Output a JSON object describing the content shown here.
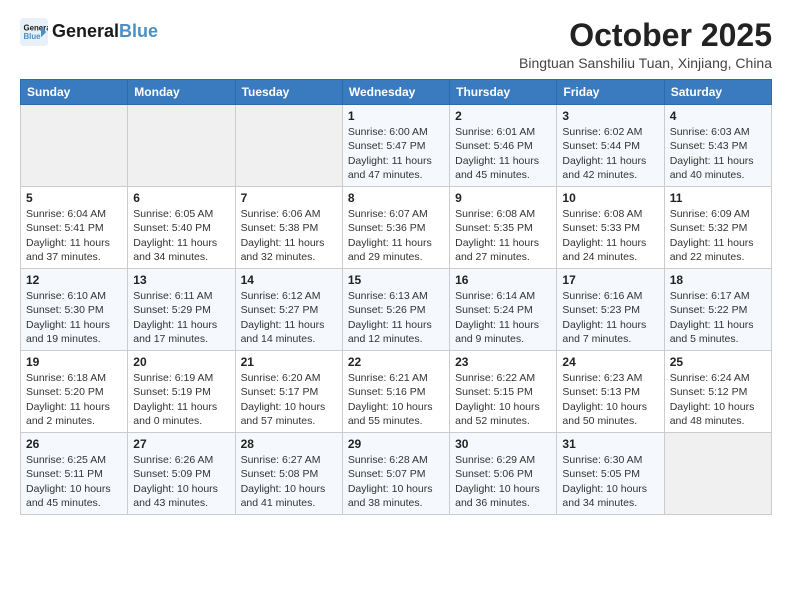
{
  "logo": {
    "line1": "General",
    "line2": "Blue",
    "icon_color": "#4a90c4"
  },
  "header": {
    "month_title": "October 2025",
    "subtitle": "Bingtuan Sanshiliu Tuan, Xinjiang, China"
  },
  "weekdays": [
    "Sunday",
    "Monday",
    "Tuesday",
    "Wednesday",
    "Thursday",
    "Friday",
    "Saturday"
  ],
  "weeks": [
    [
      {
        "day": "",
        "info": ""
      },
      {
        "day": "",
        "info": ""
      },
      {
        "day": "",
        "info": ""
      },
      {
        "day": "1",
        "info": "Sunrise: 6:00 AM\nSunset: 5:47 PM\nDaylight: 11 hours\nand 47 minutes."
      },
      {
        "day": "2",
        "info": "Sunrise: 6:01 AM\nSunset: 5:46 PM\nDaylight: 11 hours\nand 45 minutes."
      },
      {
        "day": "3",
        "info": "Sunrise: 6:02 AM\nSunset: 5:44 PM\nDaylight: 11 hours\nand 42 minutes."
      },
      {
        "day": "4",
        "info": "Sunrise: 6:03 AM\nSunset: 5:43 PM\nDaylight: 11 hours\nand 40 minutes."
      }
    ],
    [
      {
        "day": "5",
        "info": "Sunrise: 6:04 AM\nSunset: 5:41 PM\nDaylight: 11 hours\nand 37 minutes."
      },
      {
        "day": "6",
        "info": "Sunrise: 6:05 AM\nSunset: 5:40 PM\nDaylight: 11 hours\nand 34 minutes."
      },
      {
        "day": "7",
        "info": "Sunrise: 6:06 AM\nSunset: 5:38 PM\nDaylight: 11 hours\nand 32 minutes."
      },
      {
        "day": "8",
        "info": "Sunrise: 6:07 AM\nSunset: 5:36 PM\nDaylight: 11 hours\nand 29 minutes."
      },
      {
        "day": "9",
        "info": "Sunrise: 6:08 AM\nSunset: 5:35 PM\nDaylight: 11 hours\nand 27 minutes."
      },
      {
        "day": "10",
        "info": "Sunrise: 6:08 AM\nSunset: 5:33 PM\nDaylight: 11 hours\nand 24 minutes."
      },
      {
        "day": "11",
        "info": "Sunrise: 6:09 AM\nSunset: 5:32 PM\nDaylight: 11 hours\nand 22 minutes."
      }
    ],
    [
      {
        "day": "12",
        "info": "Sunrise: 6:10 AM\nSunset: 5:30 PM\nDaylight: 11 hours\nand 19 minutes."
      },
      {
        "day": "13",
        "info": "Sunrise: 6:11 AM\nSunset: 5:29 PM\nDaylight: 11 hours\nand 17 minutes."
      },
      {
        "day": "14",
        "info": "Sunrise: 6:12 AM\nSunset: 5:27 PM\nDaylight: 11 hours\nand 14 minutes."
      },
      {
        "day": "15",
        "info": "Sunrise: 6:13 AM\nSunset: 5:26 PM\nDaylight: 11 hours\nand 12 minutes."
      },
      {
        "day": "16",
        "info": "Sunrise: 6:14 AM\nSunset: 5:24 PM\nDaylight: 11 hours\nand 9 minutes."
      },
      {
        "day": "17",
        "info": "Sunrise: 6:16 AM\nSunset: 5:23 PM\nDaylight: 11 hours\nand 7 minutes."
      },
      {
        "day": "18",
        "info": "Sunrise: 6:17 AM\nSunset: 5:22 PM\nDaylight: 11 hours\nand 5 minutes."
      }
    ],
    [
      {
        "day": "19",
        "info": "Sunrise: 6:18 AM\nSunset: 5:20 PM\nDaylight: 11 hours\nand 2 minutes."
      },
      {
        "day": "20",
        "info": "Sunrise: 6:19 AM\nSunset: 5:19 PM\nDaylight: 11 hours\nand 0 minutes."
      },
      {
        "day": "21",
        "info": "Sunrise: 6:20 AM\nSunset: 5:17 PM\nDaylight: 10 hours\nand 57 minutes."
      },
      {
        "day": "22",
        "info": "Sunrise: 6:21 AM\nSunset: 5:16 PM\nDaylight: 10 hours\nand 55 minutes."
      },
      {
        "day": "23",
        "info": "Sunrise: 6:22 AM\nSunset: 5:15 PM\nDaylight: 10 hours\nand 52 minutes."
      },
      {
        "day": "24",
        "info": "Sunrise: 6:23 AM\nSunset: 5:13 PM\nDaylight: 10 hours\nand 50 minutes."
      },
      {
        "day": "25",
        "info": "Sunrise: 6:24 AM\nSunset: 5:12 PM\nDaylight: 10 hours\nand 48 minutes."
      }
    ],
    [
      {
        "day": "26",
        "info": "Sunrise: 6:25 AM\nSunset: 5:11 PM\nDaylight: 10 hours\nand 45 minutes."
      },
      {
        "day": "27",
        "info": "Sunrise: 6:26 AM\nSunset: 5:09 PM\nDaylight: 10 hours\nand 43 minutes."
      },
      {
        "day": "28",
        "info": "Sunrise: 6:27 AM\nSunset: 5:08 PM\nDaylight: 10 hours\nand 41 minutes."
      },
      {
        "day": "29",
        "info": "Sunrise: 6:28 AM\nSunset: 5:07 PM\nDaylight: 10 hours\nand 38 minutes."
      },
      {
        "day": "30",
        "info": "Sunrise: 6:29 AM\nSunset: 5:06 PM\nDaylight: 10 hours\nand 36 minutes."
      },
      {
        "day": "31",
        "info": "Sunrise: 6:30 AM\nSunset: 5:05 PM\nDaylight: 10 hours\nand 34 minutes."
      },
      {
        "day": "",
        "info": ""
      }
    ]
  ]
}
